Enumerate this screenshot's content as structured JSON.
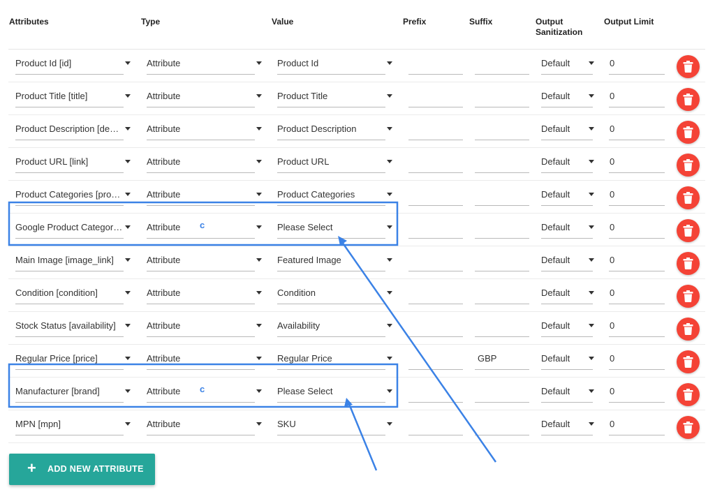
{
  "headers": {
    "attributes": "Attributes",
    "type": "Type",
    "value": "Value",
    "prefix": "Prefix",
    "suffix": "Suffix",
    "output_sanitization_line1": "Output",
    "output_sanitization_line2": "Sanitization",
    "output_limit": "Output Limit"
  },
  "rows": [
    {
      "attribute": "Product Id [id]",
      "type": "Attribute",
      "value": "Product Id",
      "prefix": "",
      "suffix": "",
      "sanitization": "Default",
      "limit": "0"
    },
    {
      "attribute": "Product Title [title]",
      "type": "Attribute",
      "value": "Product Title",
      "prefix": "",
      "suffix": "",
      "sanitization": "Default",
      "limit": "0"
    },
    {
      "attribute": "Product Description [description]",
      "type": "Attribute",
      "value": "Product Description",
      "prefix": "",
      "suffix": "",
      "sanitization": "Default",
      "limit": "0"
    },
    {
      "attribute": "Product URL [link]",
      "type": "Attribute",
      "value": "Product URL",
      "prefix": "",
      "suffix": "",
      "sanitization": "Default",
      "limit": "0"
    },
    {
      "attribute": "Product Categories [product_type]",
      "type": "Attribute",
      "value": "Product Categories",
      "prefix": "",
      "suffix": "",
      "sanitization": "Default",
      "limit": "0"
    },
    {
      "attribute": "Google Product Category [google_product_category]",
      "type": "Attribute",
      "value": "Please Select",
      "prefix": "",
      "suffix": "",
      "sanitization": "Default",
      "limit": "0",
      "marker": "c"
    },
    {
      "attribute": "Main Image [image_link]",
      "type": "Attribute",
      "value": "Featured Image",
      "prefix": "",
      "suffix": "",
      "sanitization": "Default",
      "limit": "0"
    },
    {
      "attribute": "Condition [condition]",
      "type": "Attribute",
      "value": "Condition",
      "prefix": "",
      "suffix": "",
      "sanitization": "Default",
      "limit": "0"
    },
    {
      "attribute": "Stock Status [availability]",
      "type": "Attribute",
      "value": "Availability",
      "prefix": "",
      "suffix": "",
      "sanitization": "Default",
      "limit": "0"
    },
    {
      "attribute": "Regular Price [price]",
      "type": "Attribute",
      "value": "Regular Price",
      "prefix": "",
      "suffix": "GBP",
      "sanitization": "Default",
      "limit": "0"
    },
    {
      "attribute": "Manufacturer [brand]",
      "type": "Attribute",
      "value": "Please Select",
      "prefix": "",
      "suffix": "",
      "sanitization": "Default",
      "limit": "0",
      "marker": "c"
    },
    {
      "attribute": "MPN [mpn]",
      "type": "Attribute",
      "value": "SKU",
      "prefix": "",
      "suffix": "",
      "sanitization": "Default",
      "limit": "0"
    }
  ],
  "add_button": {
    "icon": "+",
    "label": "ADD NEW ATTRIBUTE"
  },
  "icons": {
    "delete": "trash-icon",
    "dropdown": "caret-down-icon"
  },
  "colors": {
    "delete_button": "#f44336",
    "add_button": "#26a69a",
    "annotation": "#3b82e6"
  }
}
